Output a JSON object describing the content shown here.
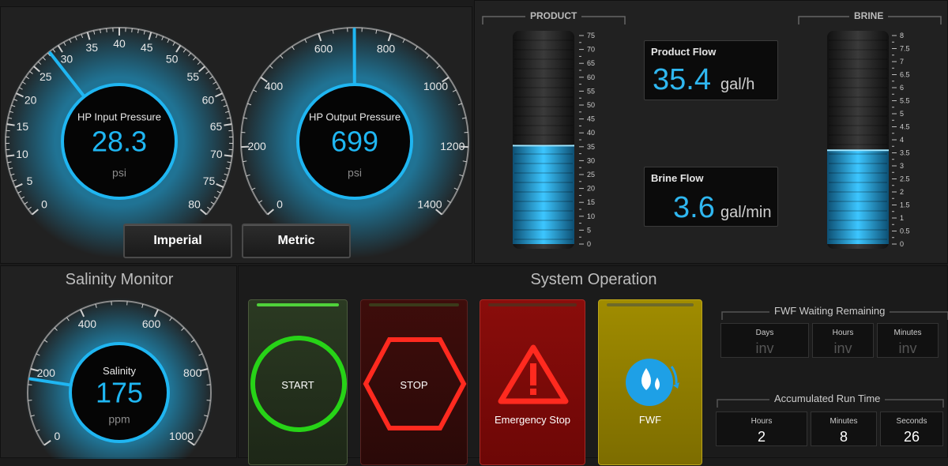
{
  "gauges": {
    "input": {
      "label": "HP Input Pressure",
      "value": "28.3",
      "unit": "psi",
      "value_num": 28.3,
      "min": 0,
      "max": 80,
      "ticks": [
        "0",
        "5",
        "10",
        "15",
        "20",
        "25",
        "30",
        "35",
        "40",
        "45",
        "50",
        "55",
        "60",
        "65",
        "70",
        "75",
        "80"
      ]
    },
    "output": {
      "label": "HP Output Pressure",
      "value": "699",
      "unit": "psi",
      "value_num": 699,
      "min": 0,
      "max": 1400,
      "ticks": [
        "0",
        "200",
        "400",
        "600",
        "800",
        "1000",
        "1200",
        "1400"
      ]
    },
    "salinity": {
      "label": "Salinity",
      "value": "175",
      "unit": "ppm",
      "value_num": 175,
      "min": 0,
      "max": 1000,
      "ticks": [
        "0",
        "200",
        "400",
        "600",
        "800",
        "1000"
      ]
    }
  },
  "units_buttons": {
    "imperial": "Imperial",
    "metric": "Metric"
  },
  "tanks": {
    "product": {
      "label": "PRODUCT",
      "value_num": 35.4,
      "max": 75,
      "ticks": [
        "75",
        "70",
        "65",
        "60",
        "55",
        "50",
        "45",
        "40",
        "35",
        "30",
        "25",
        "20",
        "15",
        "10",
        "5",
        "0"
      ]
    },
    "brine": {
      "label": "BRINE",
      "value_num": 3.6,
      "max": 8,
      "ticks": [
        "8",
        "7.5",
        "7",
        "6.5",
        "6",
        "5.5",
        "5",
        "4.5",
        "4",
        "3.5",
        "3",
        "2.5",
        "2",
        "1.5",
        "1",
        "0.5",
        "0"
      ]
    }
  },
  "flows": {
    "product": {
      "label": "Product Flow",
      "value": "35.4",
      "unit": "gal/h"
    },
    "brine": {
      "label": "Brine Flow",
      "value": "3.6",
      "unit": "gal/min"
    }
  },
  "sections": {
    "salinity": "Salinity Monitor",
    "operation": "System Operation"
  },
  "controls": {
    "start": "START",
    "stop": "STOP",
    "estop": "Emergency Stop",
    "fwf": "FWF"
  },
  "fwf_wait": {
    "title": "FWF Waiting Remaining",
    "days_label": "Days",
    "days": "inv",
    "hours_label": "Hours",
    "hours": "inv",
    "minutes_label": "Minutes",
    "minutes": "inv"
  },
  "run_time": {
    "title": "Accumulated Run Time",
    "hours_label": "Hours",
    "hours": "2",
    "minutes_label": "Minutes",
    "minutes": "8",
    "seconds_label": "Seconds",
    "seconds": "26"
  },
  "colors": {
    "accent": "#1fb6f2",
    "start": "#27d317",
    "stop": "#ff2a1f",
    "fwf": "#a28f00"
  }
}
